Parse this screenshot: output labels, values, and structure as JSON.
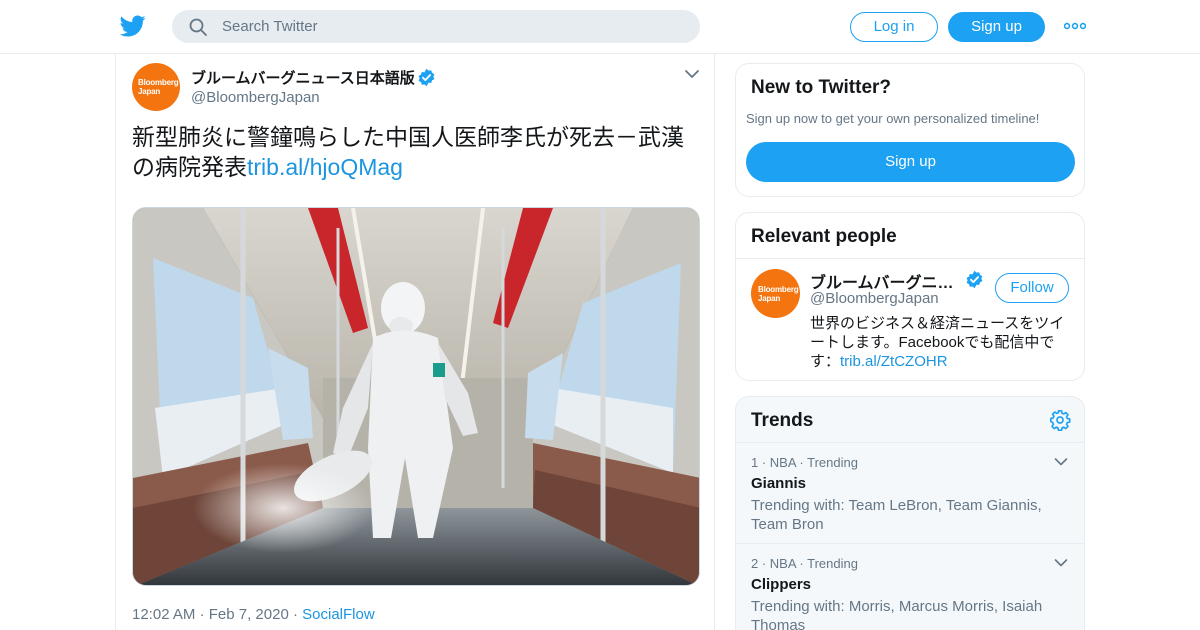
{
  "header": {
    "search_placeholder": "Search Twitter",
    "login_label": "Log in",
    "signup_label": "Sign up",
    "brand_color": "#1da1f2"
  },
  "tweet": {
    "avatar_text": "Bloomberg Japan",
    "author_name": "ブルームバーグニュース日本語版",
    "author_handle": "@BloombergJapan",
    "text": "新型肺炎に警鐘鳴らした中国人医師李氏が死去－武漢の病院発表",
    "link": "trib.al/hjoQMag",
    "time": "12:02 AM",
    "date": "Feb 7, 2020",
    "source": "SocialFlow",
    "separator": "·"
  },
  "sidebar": {
    "new_to_twitter": {
      "title": "New to Twitter?",
      "subtitle": "Sign up now to get your own personalized timeline!",
      "signup_label": "Sign up"
    },
    "relevant_people": {
      "title": "Relevant people",
      "avatar_text": "Bloomberg Japan",
      "name": "ブルームバーグニュース日本語版",
      "handle": "@BloombergJapan",
      "follow_label": "Follow",
      "bio": "世界のビジネス＆経済ニュースをツイートします。Facebookでも配信中です：",
      "bio_link": "trib.al/ZtCZOHR"
    },
    "trends": {
      "title": "Trends",
      "items": [
        {
          "meta": "1 · NBA · Trending",
          "name": "Giannis",
          "with": "Trending with: Team LeBron, Team Giannis, Team Bron"
        },
        {
          "meta": "2 · NBA · Trending",
          "name": "Clippers",
          "with": "Trending with: Morris, Marcus Morris, Isaiah Thomas"
        }
      ]
    }
  }
}
